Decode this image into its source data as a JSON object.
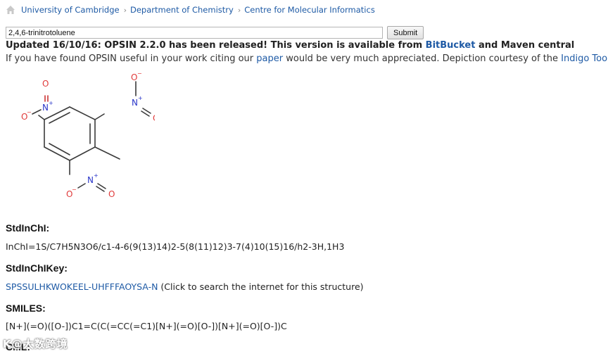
{
  "breadcrumb": [
    {
      "label": "University of Cambridge"
    },
    {
      "label": "Department of Chemistry"
    },
    {
      "label": "Centre for Molecular Informatics"
    }
  ],
  "breadcrumb_separator": "›",
  "search": {
    "value": "2,4,6-trinitrotoluene",
    "submit_label": "Submit"
  },
  "announcement": {
    "prefix": "Updated 16/10/16: OPSIN 2.2.0 has been released! This version is available from ",
    "link": "BitBucket",
    "suffix": " and Maven central"
  },
  "citation": {
    "prefix": "If you have found OPSIN useful in your work citing our ",
    "paper_link": "paper",
    "middle": " would be very much appreciated. Depiction courtesy of the ",
    "indigo_link": "Indigo Toolkit"
  },
  "structure_labels": {
    "n_plus": "N",
    "charge_plus": "+",
    "charge_minus": "−",
    "oxygen": "O"
  },
  "sections": {
    "stdinchi_label": "StdInChI:",
    "stdinchi_value": "InChI=1S/C7H5N3O6/c1-4-6(9(13)14)2-5(8(11)12)3-7(4)10(15)16/h2-3H,1H3",
    "stdinchikey_label": "StdInChIKey:",
    "stdinchikey_value": "SPSSULHKWOKEEL-UHFFFAOYSA-N",
    "stdinchikey_note": " (Click to search the internet for this structure)",
    "smiles_label": "SMILES:",
    "smiles_value": "[N+](=O)([O-])C1=C(C(=CC(=C1)[N+](=O)[O-])[N+](=O)[O-])C",
    "cml_label": "CML:"
  },
  "watermark": "K@大数跨境",
  "colors": {
    "link": "#1e5aa5",
    "nitrogen": "#2a36c9",
    "oxygen": "#e03a3a",
    "bond": "#3a3a3a"
  },
  "icons": {
    "home": "home-icon"
  }
}
